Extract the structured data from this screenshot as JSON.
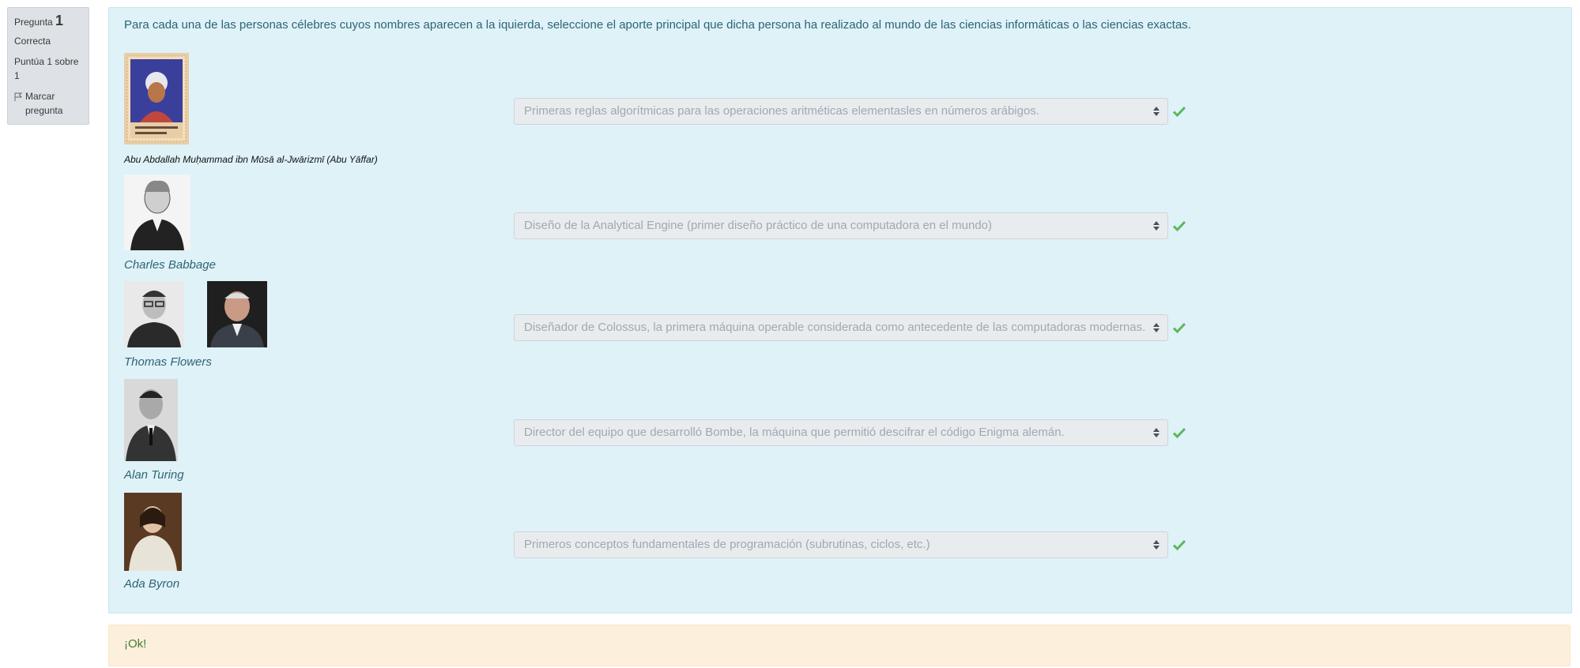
{
  "info": {
    "question_prefix": "Pregunta",
    "question_number": "1",
    "state": "Correcta",
    "grade": "Puntúa 1 sobre 1",
    "flag_label": "Marcar pregunta",
    "flag_icon": "flag-icon"
  },
  "question_text": "Para cada una de las personas célebres cuyos nombres aparecen a la iquierda, seleccione el aporte principal que dicha persona ha realizado al mundo de las ciencias informáticas o las ciencias exactas.",
  "rows": [
    {
      "name": "Abu Abdallah Muḥammad ibn Mūsā al-Jwārizmī (Abu Yāffar)",
      "answer": "Primeras reglas algorítmicas para las operaciones aritméticas elementasles en números arábigos.",
      "status_icon": "check-icon"
    },
    {
      "name": "Charles Babbage",
      "answer": "Diseño de la Analytical Engine (primer diseño práctico de una computadora en el mundo)",
      "status_icon": "check-icon"
    },
    {
      "name": "Thomas Flowers",
      "answer": "Diseñador de Colossus, la primera máquina operable considerada como antecedente de las computadoras modernas.",
      "status_icon": "check-icon"
    },
    {
      "name": "Alan Turing",
      "answer": "Director del equipo que desarrolló Bombe, la máquina que permitió descifrar el código Enigma alemán.",
      "status_icon": "check-icon"
    },
    {
      "name": "Ada Byron",
      "answer": "Primeros conceptos fundamentales de programación (subrutinas, ciclos, etc.)",
      "status_icon": "check-icon"
    }
  ],
  "feedback": "¡Ok!",
  "colors": {
    "info_bg": "#dee2e6",
    "formulation_bg": "#def2f8",
    "feedback_bg": "#fcefdc",
    "correct_green": "#5cb85c"
  }
}
